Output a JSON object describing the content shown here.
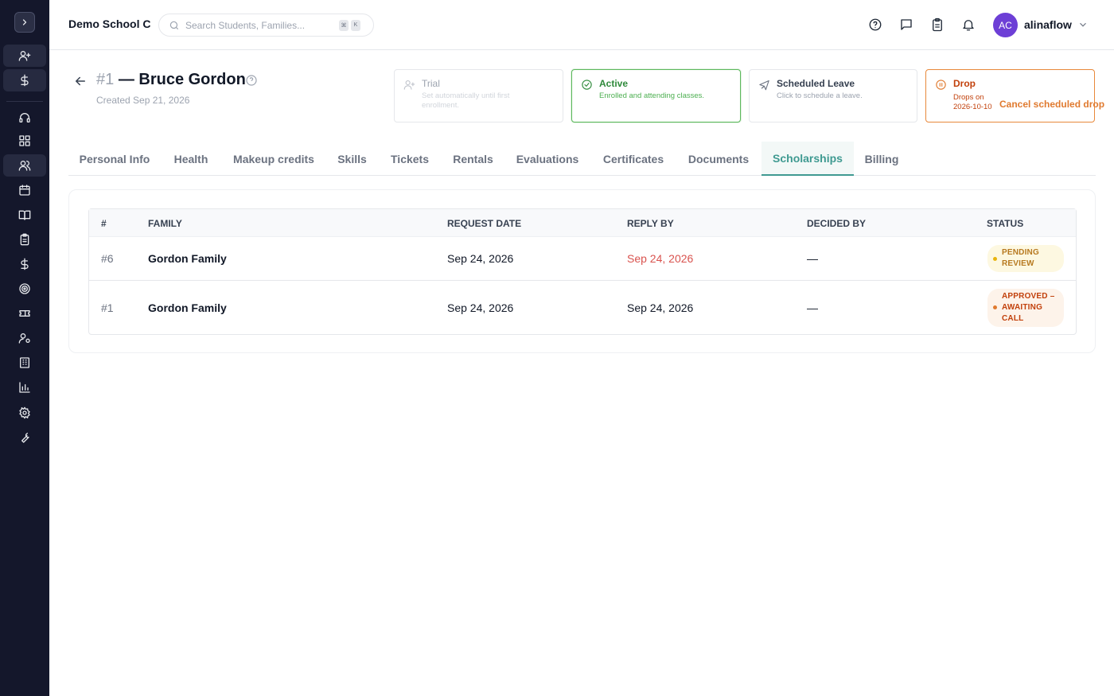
{
  "header": {
    "school_name": "Demo School C",
    "search_placeholder": "Search Students, Families...",
    "search_shortcut": [
      "⌘",
      "K"
    ],
    "user": {
      "initials": "AC",
      "name": "alinaflow",
      "avatar_color": "#6d3fd6"
    }
  },
  "sidebar": {
    "items": [
      {
        "icon": "user-plus-icon"
      },
      {
        "icon": "dollar-icon"
      },
      {
        "icon": "headset-icon"
      },
      {
        "icon": "dashboard-icon"
      },
      {
        "icon": "users-icon",
        "active": true
      },
      {
        "icon": "calendar-icon"
      },
      {
        "icon": "book-icon"
      },
      {
        "icon": "clipboard-icon"
      },
      {
        "icon": "dollar-icon"
      },
      {
        "icon": "target-icon"
      },
      {
        "icon": "ticket-icon"
      },
      {
        "icon": "user-gear-icon"
      },
      {
        "icon": "building-icon"
      },
      {
        "icon": "bar-chart-icon"
      },
      {
        "icon": "settings-icon"
      },
      {
        "icon": "wrench-icon"
      }
    ]
  },
  "student": {
    "number": "#1",
    "separator": "—",
    "name": "Bruce Gordon",
    "created": "Created Sep 21, 2026"
  },
  "status_cards": {
    "trial": {
      "label": "Trial",
      "description": "Set automatically until first enrollment."
    },
    "active": {
      "label": "Active",
      "description": "Enrolled and attending classes."
    },
    "leave": {
      "label": "Scheduled Leave",
      "description": "Click to schedule a leave."
    },
    "drop": {
      "label": "Drop",
      "description": "Drops on 2026-10-10",
      "action": "Cancel scheduled drop"
    }
  },
  "tabs": [
    "Personal Info",
    "Health",
    "Makeup credits",
    "Skills",
    "Tickets",
    "Rentals",
    "Evaluations",
    "Certificates",
    "Documents",
    "Scholarships",
    "Billing"
  ],
  "active_tab": "Scholarships",
  "table": {
    "columns": [
      "#",
      "FAMILY",
      "REQUEST DATE",
      "REPLY BY",
      "DECIDED BY",
      "STATUS"
    ],
    "rows": [
      {
        "id": "#6",
        "family": "Gordon Family",
        "request_date": "Sep 24, 2026",
        "reply_by": "Sep 24, 2026",
        "reply_overdue": true,
        "decided_by": "—",
        "status": "PENDING REVIEW"
      },
      {
        "id": "#1",
        "family": "Gordon Family",
        "request_date": "Sep 24, 2026",
        "reply_by": "Sep 24, 2026",
        "reply_overdue": false,
        "decided_by": "—",
        "status": "APPROVED – AWAITING CALL"
      }
    ]
  },
  "colors": {
    "accent": "#3f9a91",
    "active_green": "#2f8a3b",
    "drop_orange": "#e07a2f",
    "overdue_red": "#d9534f",
    "sidebar_bg": "#14172b"
  }
}
